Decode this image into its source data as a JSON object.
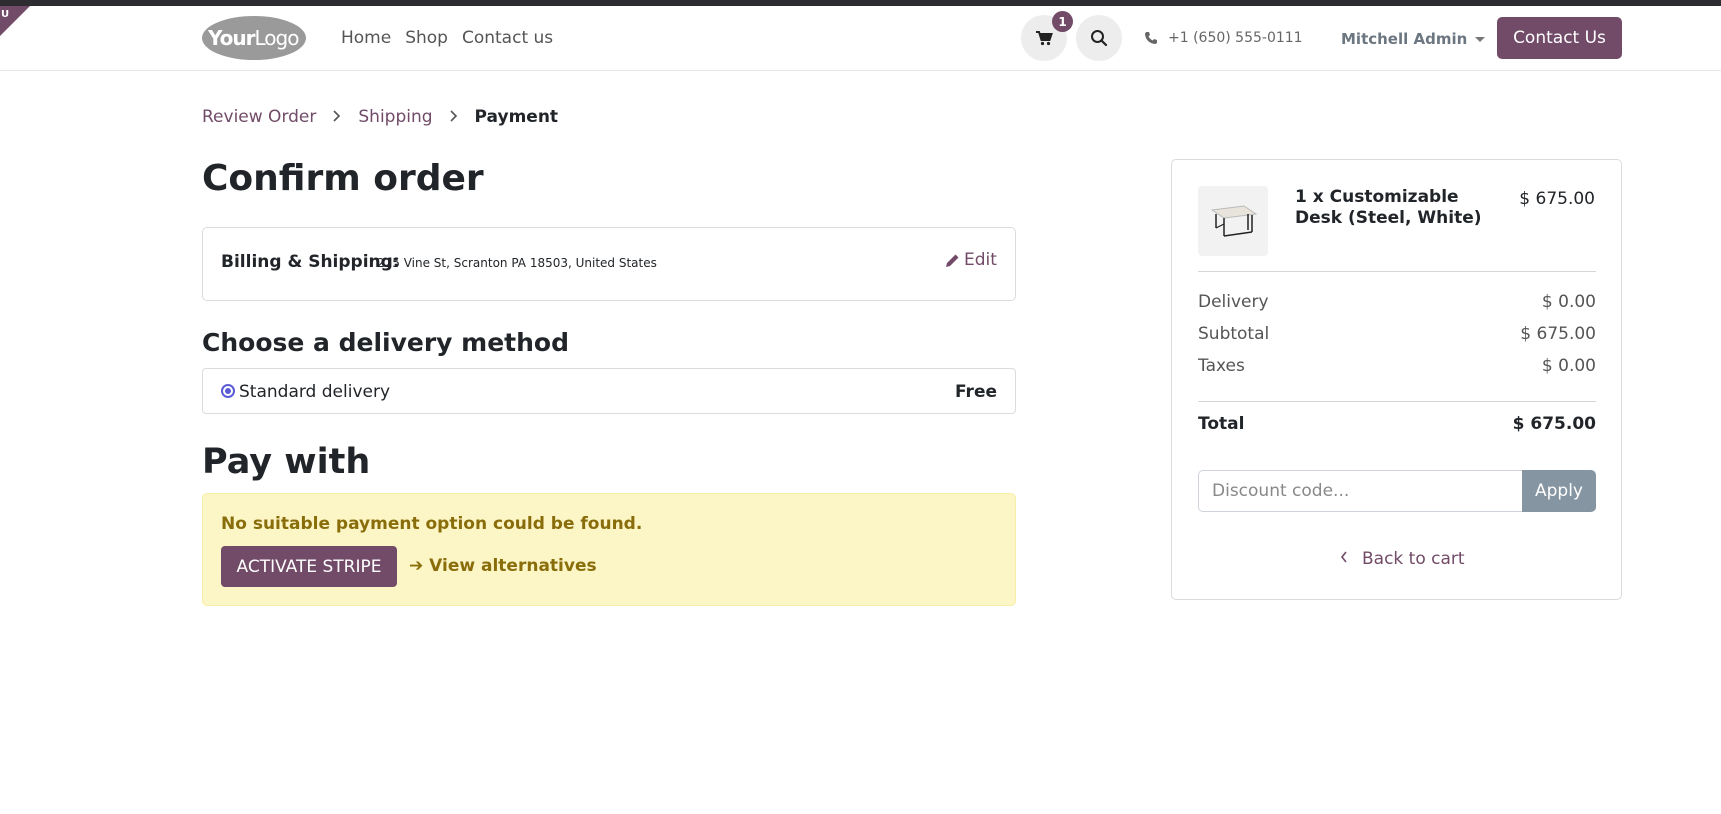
{
  "header": {
    "logo": {
      "bold": "Your",
      "light": "Logo"
    },
    "nav": [
      "Home",
      "Shop",
      "Contact us"
    ],
    "cart_count": "1",
    "phone": "+1 (650) 555-0111",
    "user": "Mitchell Admin",
    "contact_button": "Contact Us",
    "ribbon": "U"
  },
  "breadcrumb": {
    "steps": [
      "Review Order",
      "Shipping"
    ],
    "current": "Payment"
  },
  "page_title": "Confirm order",
  "billing": {
    "label": "Billing & Shipping:",
    "address": "215 Vine St, Scranton PA 18503, United States",
    "edit": "Edit"
  },
  "delivery": {
    "heading": "Choose a delivery method",
    "option": "Standard delivery",
    "price": "Free",
    "selected": true
  },
  "payment": {
    "heading": "Pay with",
    "message": "No suitable payment option could be found.",
    "activate_button": "ACTIVATE STRIPE",
    "alternatives": "➔ View alternatives"
  },
  "summary": {
    "product_name": "1 x Customizable Desk (Steel, White)",
    "product_price": "$ 675.00",
    "rows": [
      {
        "label": "Delivery",
        "value": "$ 0.00"
      },
      {
        "label": "Subtotal",
        "value": "$ 675.00"
      },
      {
        "label": "Taxes",
        "value": "$ 0.00"
      }
    ],
    "total_label": "Total",
    "total_value": "$ 675.00",
    "discount_placeholder": "Discount code...",
    "apply": "Apply",
    "back_to_cart": "Back to cart"
  },
  "colors": {
    "brand": "#714b67",
    "alert_bg": "#fcf6c6",
    "alert_text": "#8a6d0b",
    "apply_bg": "#8595a2"
  }
}
